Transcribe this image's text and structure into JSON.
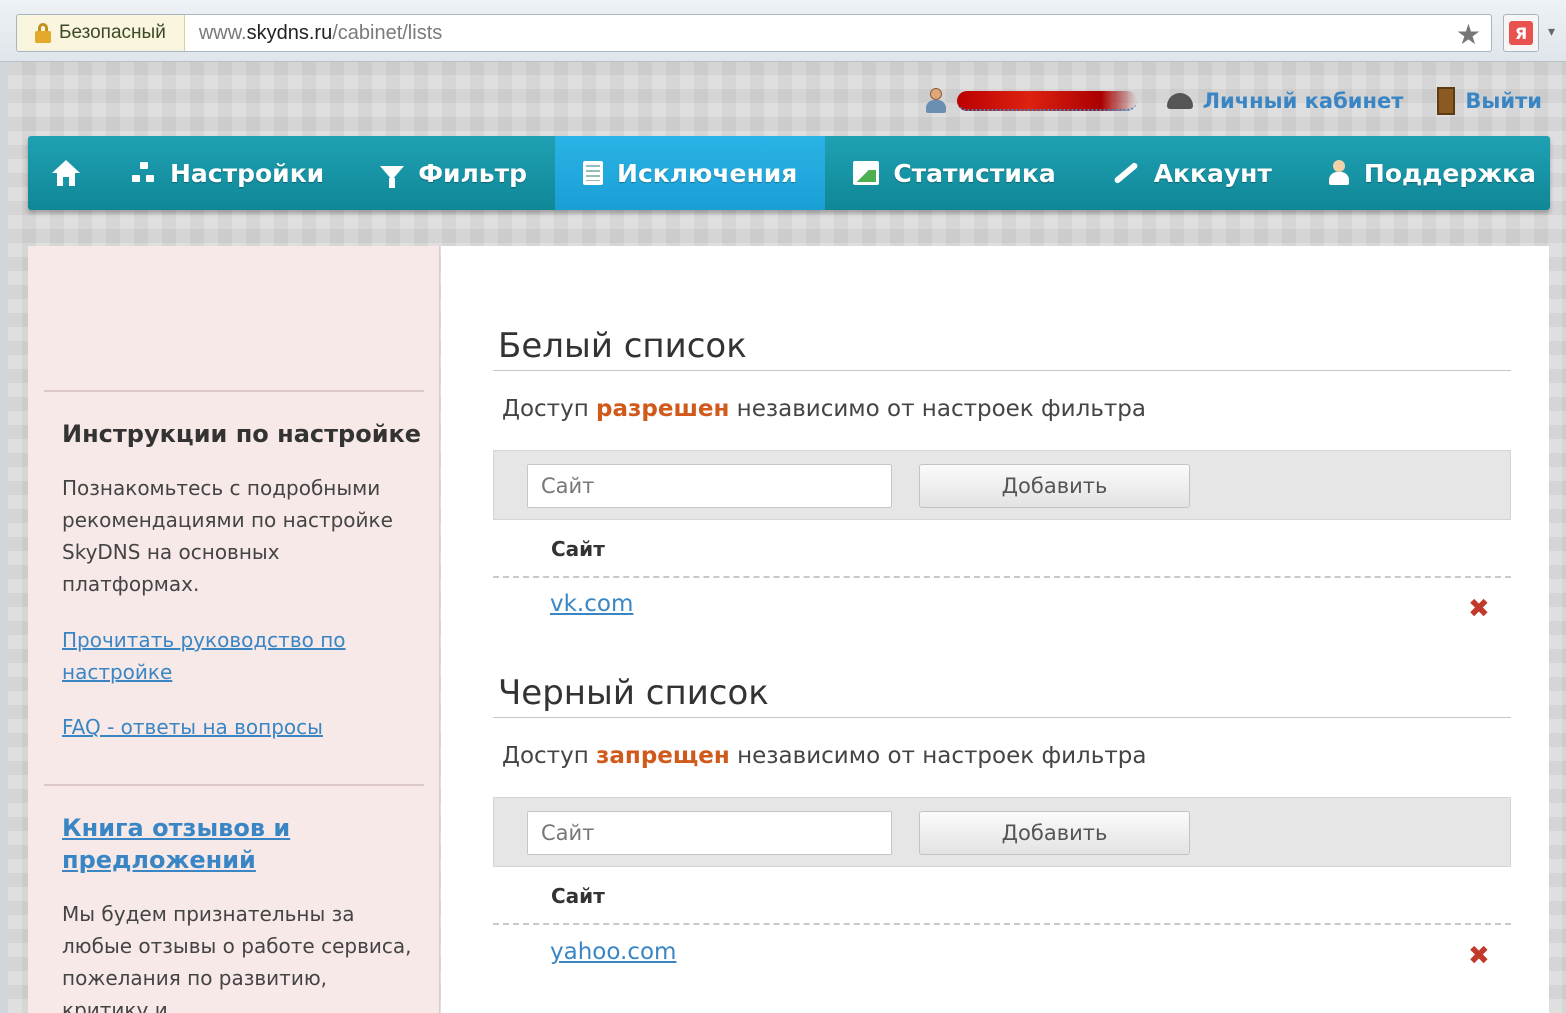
{
  "browser": {
    "secure_label": "Безопасный",
    "url_host": "www.skydns.ru",
    "url_path": "/cabinet/lists",
    "yandex_label": "Я"
  },
  "userbar": {
    "cabinet_label": "Личный кабинет",
    "logout_label": "Выйти"
  },
  "nav": {
    "items": [
      {
        "label": "Настройки",
        "icon": "settings-icon"
      },
      {
        "label": "Фильтр",
        "icon": "filter-icon"
      },
      {
        "label": "Исключения",
        "icon": "list-icon",
        "active": true
      },
      {
        "label": "Статистика",
        "icon": "stats-icon"
      },
      {
        "label": "Аккаунт",
        "icon": "wrench-icon"
      },
      {
        "label": "Поддержка",
        "icon": "support-icon"
      }
    ]
  },
  "sidebar": {
    "instructions_heading": "Инструкции по настройке",
    "instructions_text": "Познакомьтесь с подробными рекомендациями по настройке SkyDNS на основных платформах.",
    "guide_link": "Прочитать руководство по настройке",
    "faq_link": "FAQ - ответы на вопросы",
    "feedback_heading": "Книга отзывов и предложений",
    "feedback_text": "Мы будем признательны за любые отзывы о работе сервиса, пожелания по развитию, критику и"
  },
  "whitelist": {
    "title": "Белый список",
    "desc_before": "Доступ ",
    "desc_highlight": "разрешен",
    "desc_after": " независимо от настроек фильтра",
    "input_placeholder": "Сайт",
    "add_label": "Добавить",
    "column_header": "Сайт",
    "rows": [
      "vk.com"
    ]
  },
  "blacklist": {
    "title": "Черный список",
    "desc_before": "Доступ ",
    "desc_highlight": "запрещен",
    "desc_after": " независимо от настроек фильтра",
    "input_placeholder": "Сайт",
    "add_label": "Добавить",
    "column_header": "Сайт",
    "rows": [
      "yahoo.com"
    ]
  },
  "colors": {
    "nav_bg": "#1796a8",
    "nav_active": "#22a9dd",
    "link": "#3a86c4",
    "highlight": "#cf5a1c",
    "delete": "#c0392b",
    "sidebar_bg": "#f8e9e9"
  }
}
